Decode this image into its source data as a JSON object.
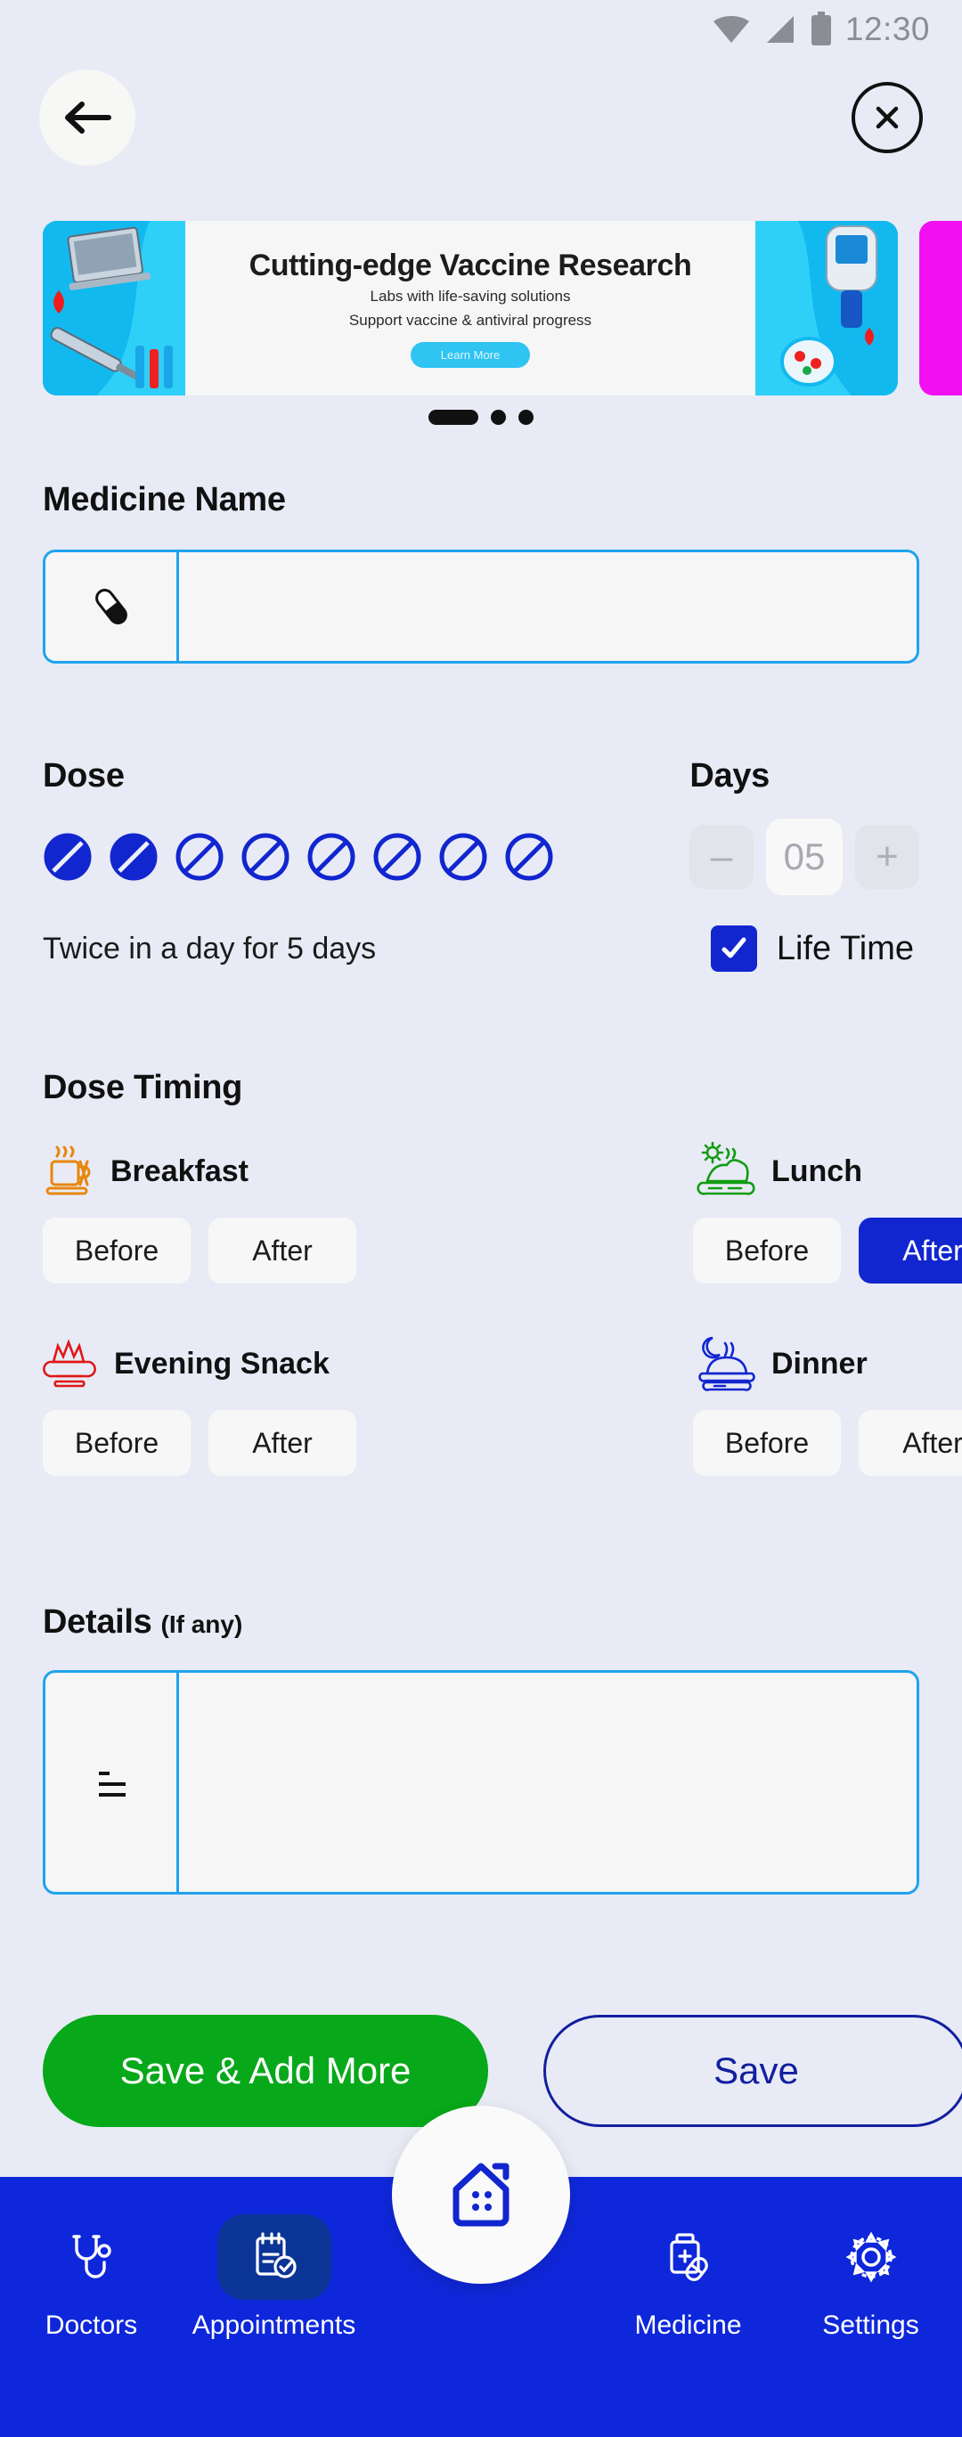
{
  "statusbar": {
    "time": "12:30",
    "icons": [
      "wifi-icon",
      "signal-icon",
      "battery-icon"
    ]
  },
  "header": {
    "back_icon": "arrow-left-icon",
    "close_icon": "close-icon"
  },
  "carousel": {
    "banner": {
      "title": "Cutting-edge Vaccine Research",
      "subtitle_line1": "Labs with life-saving solutions",
      "subtitle_line2": "Support vaccine & antiviral progress",
      "cta_label": "Learn More"
    },
    "dots": 3,
    "active_dot": 0
  },
  "medicine_name": {
    "label": "Medicine Name",
    "icon": "capsule-icon",
    "value": "",
    "placeholder": ""
  },
  "dose": {
    "label": "Dose",
    "total_pills": 8,
    "selected_pills": 2,
    "summary": "Twice in a day for 5 days"
  },
  "days": {
    "label": "Days",
    "value": "05",
    "decrement_label": "–",
    "increment_label": "+",
    "lifetime_label": "Life Time",
    "lifetime_checked": true
  },
  "dose_timing": {
    "label": "Dose Timing",
    "before_label": "Before",
    "after_label": "After",
    "meals": [
      {
        "name": "Breakfast",
        "icon": "coffee-cup-icon",
        "color": "#e8860c",
        "selected": null
      },
      {
        "name": "Lunch",
        "icon": "salad-bowl-sun-icon",
        "color": "#119c11",
        "selected": "after"
      },
      {
        "name": "Evening Snack",
        "icon": "snack-bowl-icon",
        "color": "#e01717",
        "selected": null
      },
      {
        "name": "Dinner",
        "icon": "dinner-bowl-moon-icon",
        "color": "#1226cf",
        "selected": null
      }
    ]
  },
  "details": {
    "label": "Details",
    "sub_label": "(If any)",
    "icon": "notes-lines-icon",
    "value": "",
    "placeholder": ""
  },
  "actions": {
    "primary_label": "Save & Add More",
    "secondary_label": "Save"
  },
  "bottomnav": {
    "fab_icon": "home-icon",
    "items": [
      {
        "label": "Doctors",
        "icon": "stethoscope-icon",
        "active": false
      },
      {
        "label": "Appointments",
        "icon": "clipboard-check-icon",
        "active": true
      },
      {
        "label": "",
        "icon": "",
        "active": false
      },
      {
        "label": "Medicine",
        "icon": "medicine-bottle-icon",
        "active": false
      },
      {
        "label": "Settings",
        "icon": "gear-icon",
        "active": false
      }
    ]
  },
  "colors": {
    "page_bg": "#e8ebf5",
    "accent_blue": "#1226cf",
    "nav_blue": "#0f27da",
    "nav_active": "#0a3496",
    "field_border": "#1fa3ee",
    "success_green": "#07a81a"
  }
}
